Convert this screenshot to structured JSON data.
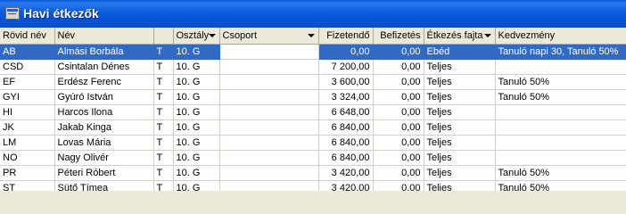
{
  "window": {
    "title": "Havi étkezők"
  },
  "columns": [
    {
      "label": "Rövid név",
      "dropdown": false,
      "numeric": false
    },
    {
      "label": "Név",
      "dropdown": false,
      "numeric": false
    },
    {
      "label": "",
      "dropdown": false,
      "numeric": false
    },
    {
      "label": "Osztály",
      "dropdown": true,
      "numeric": false
    },
    {
      "label": "Csoport",
      "dropdown": true,
      "numeric": false
    },
    {
      "label": "Fizetendő",
      "dropdown": false,
      "numeric": true
    },
    {
      "label": "Befizetés",
      "dropdown": false,
      "numeric": true
    },
    {
      "label": "Étkezés fajta",
      "dropdown": true,
      "numeric": false
    },
    {
      "label": "Kedvezmény",
      "dropdown": false,
      "numeric": false
    }
  ],
  "rows": [
    {
      "rovid": "AB",
      "nev": "Almási Borbála",
      "t": "T",
      "osztaly": "10. G",
      "csoport": "",
      "fizetendo": "0,00",
      "befizetes": "0,00",
      "fajta": "Ebéd",
      "kedvezmeny": "Tanuló napi 30, Tanuló 50%",
      "selected": true
    },
    {
      "rovid": "CSD",
      "nev": "Csintalan Dénes",
      "t": "T",
      "osztaly": "10. G",
      "csoport": "",
      "fizetendo": "7 200,00",
      "befizetes": "0,00",
      "fajta": "Teljes",
      "kedvezmeny": "",
      "selected": false
    },
    {
      "rovid": "EF",
      "nev": "Erdész Ferenc",
      "t": "T",
      "osztaly": "10. G",
      "csoport": "",
      "fizetendo": "3 600,00",
      "befizetes": "0,00",
      "fajta": "Teljes",
      "kedvezmeny": "Tanuló 50%",
      "selected": false
    },
    {
      "rovid": "GYI",
      "nev": "Gyúró István",
      "t": "T",
      "osztaly": "10. G",
      "csoport": "",
      "fizetendo": "3 324,00",
      "befizetes": "0,00",
      "fajta": "Teljes",
      "kedvezmeny": "Tanuló 50%",
      "selected": false
    },
    {
      "rovid": "HI",
      "nev": "Harcos Ilona",
      "t": "T",
      "osztaly": "10. G",
      "csoport": "",
      "fizetendo": "6 648,00",
      "befizetes": "0,00",
      "fajta": "Teljes",
      "kedvezmeny": "",
      "selected": false
    },
    {
      "rovid": "JK",
      "nev": "Jakab Kinga",
      "t": "T",
      "osztaly": "10. G",
      "csoport": "",
      "fizetendo": "6 840,00",
      "befizetes": "0,00",
      "fajta": "Teljes",
      "kedvezmeny": "",
      "selected": false
    },
    {
      "rovid": "LM",
      "nev": "Lovas Mária",
      "t": "T",
      "osztaly": "10. G",
      "csoport": "",
      "fizetendo": "6 840,00",
      "befizetes": "0,00",
      "fajta": "Teljes",
      "kedvezmeny": "",
      "selected": false
    },
    {
      "rovid": "NO",
      "nev": "Nagy Olivér",
      "t": "T",
      "osztaly": "10. G",
      "csoport": "",
      "fizetendo": "6 840,00",
      "befizetes": "0,00",
      "fajta": "Teljes",
      "kedvezmeny": "",
      "selected": false
    },
    {
      "rovid": "PR",
      "nev": "Péteri Róbert",
      "t": "T",
      "osztaly": "10. G",
      "csoport": "",
      "fizetendo": "3 420,00",
      "befizetes": "0,00",
      "fajta": "Teljes",
      "kedvezmeny": "Tanuló 50%",
      "selected": false
    },
    {
      "rovid": "ST",
      "nev": "Sütő Tímea",
      "t": "T",
      "osztaly": "10. G",
      "csoport": "",
      "fizetendo": "3 420,00",
      "befizetes": "0,00",
      "fajta": "Teljes",
      "kedvezmeny": "Tanuló 50%",
      "selected": false
    }
  ],
  "colors": {
    "titlebar": "#0553d5",
    "selection": "#316ac5",
    "header_bg": "#ece9d8"
  }
}
